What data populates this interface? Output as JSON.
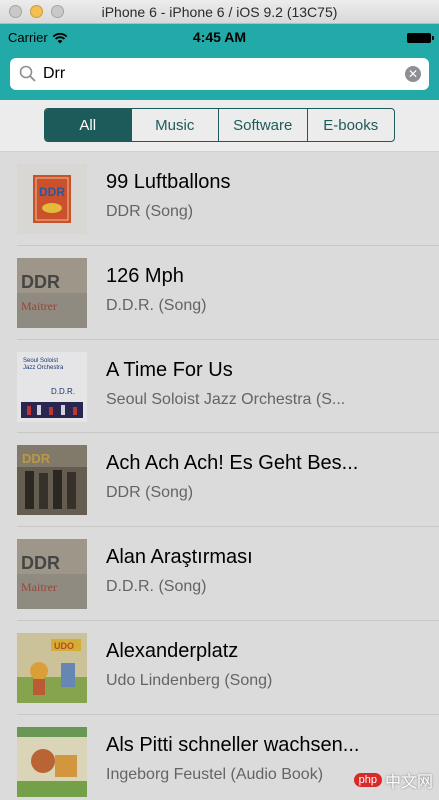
{
  "window": {
    "title": "iPhone 6 - iPhone 6 / iOS 9.2 (13C75)",
    "colors": {
      "close": "#ed6a5e",
      "minimize": "#f5bf4f",
      "zoom": "#c7c7c7"
    }
  },
  "status_bar": {
    "carrier": "Carrier",
    "time": "4:45 AM"
  },
  "search": {
    "value": "Drr",
    "background": "#22aaa8"
  },
  "segments": {
    "options": [
      "All",
      "Music",
      "Software",
      "E-books"
    ],
    "selected": "All",
    "accent": "#1d5b5b"
  },
  "results": [
    {
      "title": "99 Luftballons",
      "subtitle": "DDR (Song)",
      "art": "ddr-logo"
    },
    {
      "title": "126 Mph",
      "subtitle": "D.D.R. (Song)",
      "art": "ddr-wall"
    },
    {
      "title": "A Time For Us",
      "subtitle": "Seoul Soloist Jazz Orchestra (S...",
      "art": "seoul-jazz"
    },
    {
      "title": "Ach Ach Ach! Es Geht Bes...",
      "subtitle": "DDR (Song)",
      "art": "ddr-band"
    },
    {
      "title": "Alan Araştırması",
      "subtitle": "D.D.R. (Song)",
      "art": "ddr-wall"
    },
    {
      "title": "Alexanderplatz",
      "subtitle": "Udo Lindenberg (Song)",
      "art": "udo-cartoon"
    },
    {
      "title": "Als Pitti schneller wachsen...",
      "subtitle": "Ingeborg Feustel (Audio Book)",
      "art": "pitti-book"
    }
  ],
  "watermark": {
    "text": "中文网",
    "badge": "php"
  }
}
